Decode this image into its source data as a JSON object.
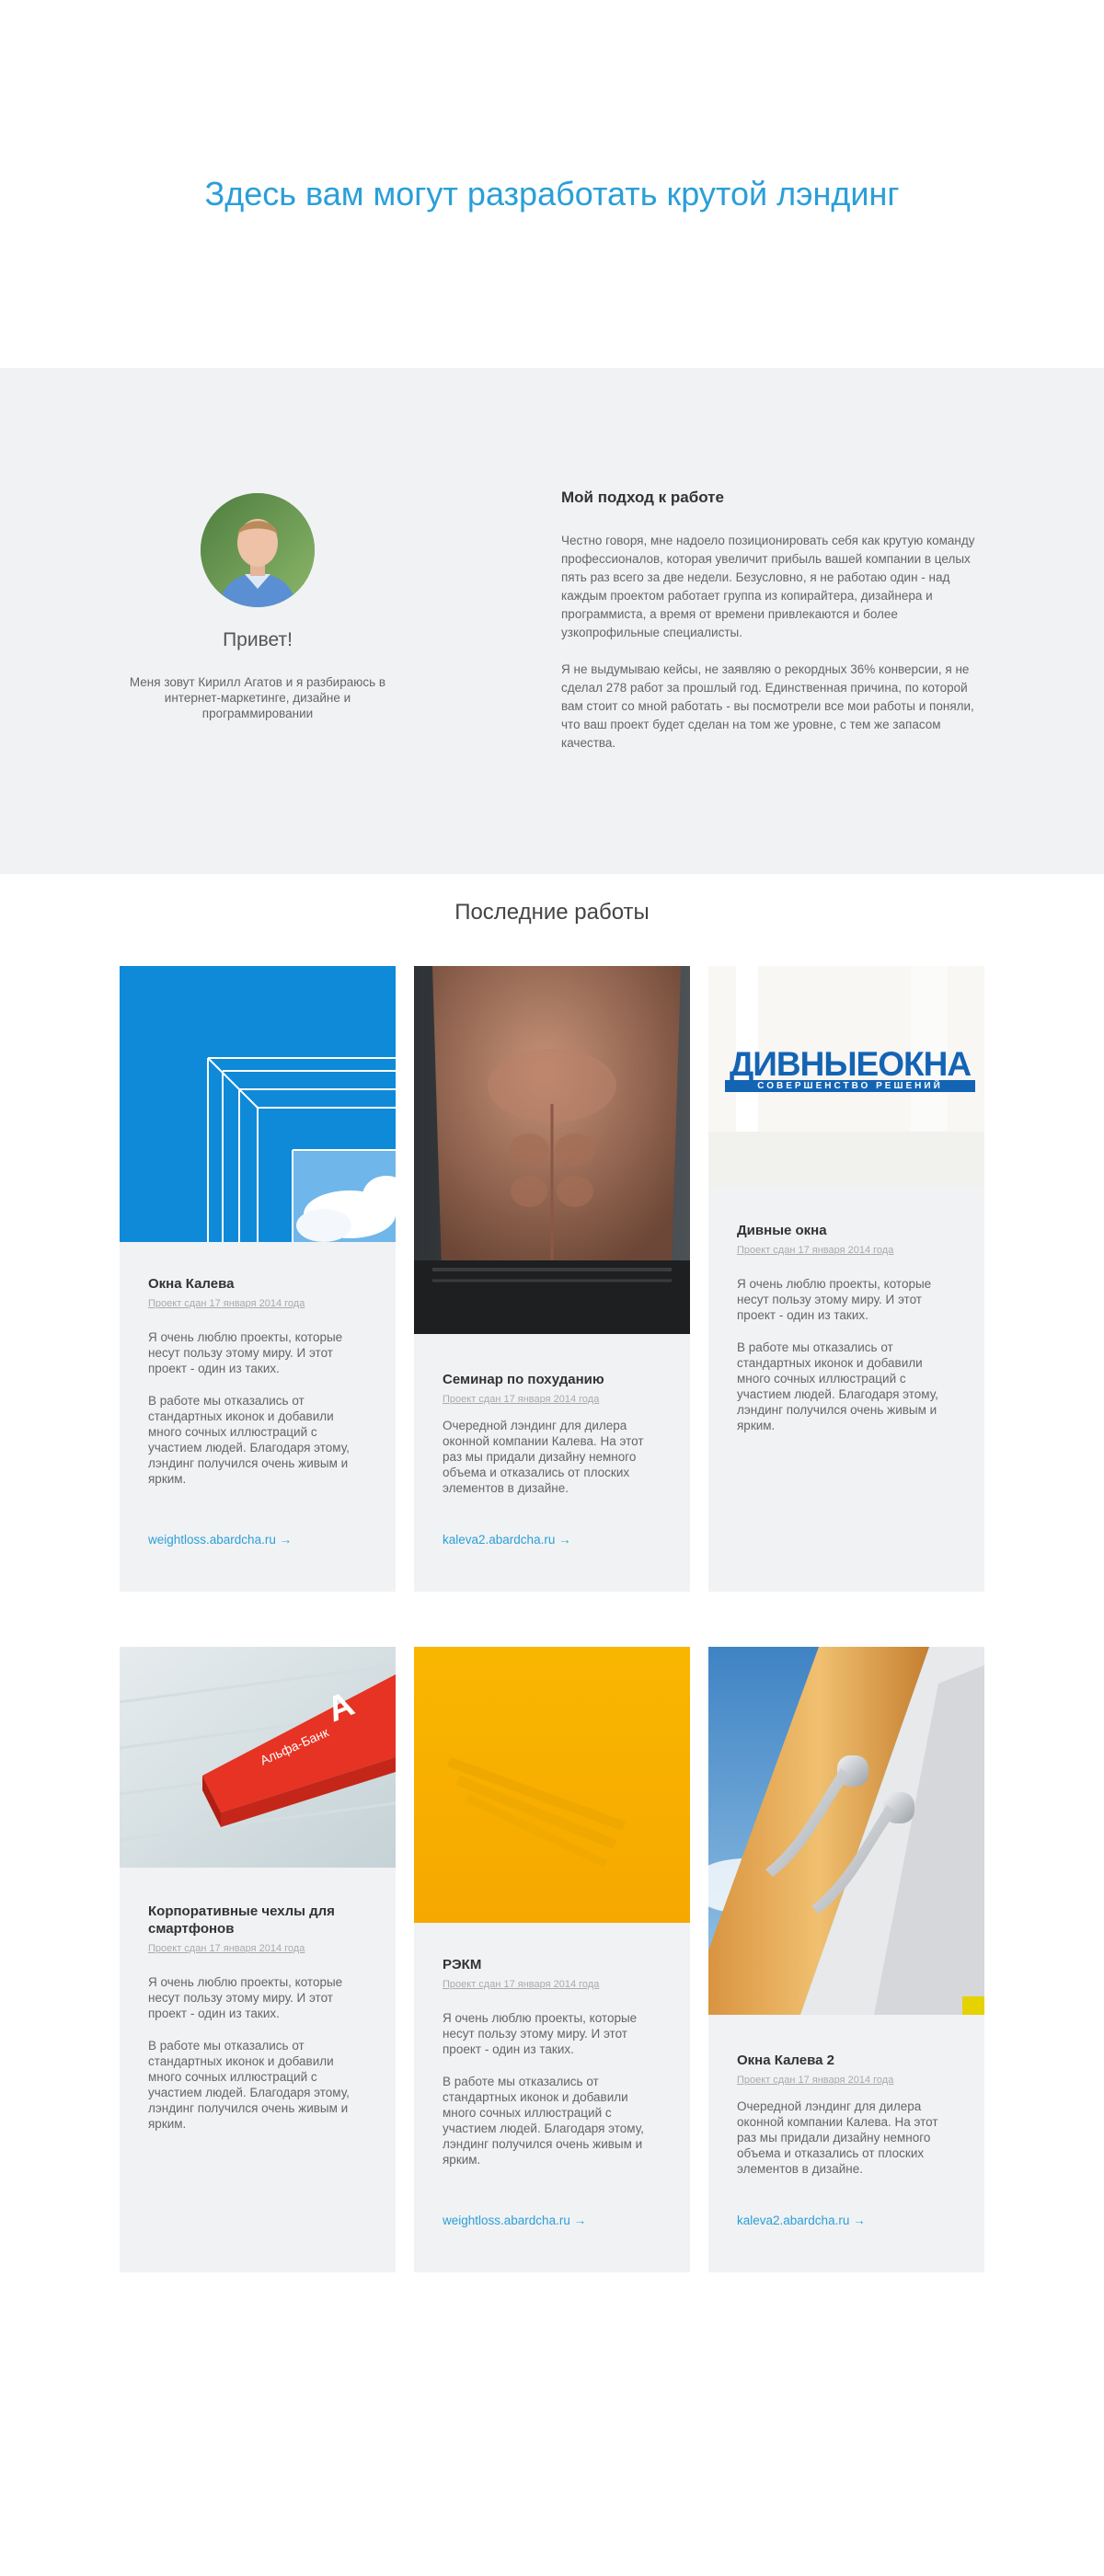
{
  "hero": {
    "title": "Здесь вам могут разработать крутой лэндинг"
  },
  "about": {
    "hello": "Привет!",
    "intro": "Меня зовут Кирилл Агатов и я разбираюсь в интернет-маркетинге, дизайне и программировании",
    "heading": "Мой подход к работе",
    "para1": "Честно говоря, мне надоело позиционировать себя как крутую команду профессионалов, которая увеличит прибыль вашей компании в целых пять раз всего за две недели. Безусловно, я не работаю один - над каждым проектом работает группа из копирайтера, дизайнера и программиста, а время от времени привлекаются и более узкопрофильные специалисты.",
    "para2": "Я не выдумываю кейсы, не заявляю о рекордных 36% конверсии, я не сделал 278 работ за прошлый год. Единственная причина, по которой вам стоит со мной работать - вы посмотрели все мои работы и поняли, что ваш проект будет сделан на том же уровне, с тем же запасом качества."
  },
  "works": {
    "title": "Последние работы",
    "cards": [
      {
        "title": "Окна Калева",
        "date": "Проект сдан 17 января 2014 года",
        "desc": "Я очень люблю проекты, которые несут пользу этому миру. И этот проект - один из таких.",
        "desc2": "В работе мы отказались от стандартных иконок и добавили много сочных иллюстраций с участием людей. Благодаря этому, лэндинг получился очень живым и ярким.",
        "link": "weightloss.abardcha.ru →"
      },
      {
        "title": "Семинар по похуданию",
        "date": "Проект сдан 17 января 2014 года",
        "desc": "Очередной лэндинг для дилера оконной компании Калева. На этот раз мы придали дизайну немного объема и отказались от плоских элементов в дизайне.",
        "desc2": "",
        "link": "kaleva2.abardcha.ru →"
      },
      {
        "title": "Дивные окна",
        "date": "Проект сдан 17 января 2014 года",
        "desc": "Я очень люблю проекты, которые несут пользу этому миру. И этот проект - один из таких.",
        "desc2": "В работе мы отказались от стандартных иконок и добавили много сочных иллюстраций с участием людей. Благодаря этому, лэндинг получился очень живым и ярким.",
        "link": "",
        "logo_main": "ДИВНЫЕОКНА",
        "logo_sub": "СОВЕРШЕНСТВО РЕШЕНИЙ"
      },
      {
        "title": "Корпоративные чехлы для смартфонов",
        "date": "Проект сдан 17 января 2014 года",
        "desc": "Я очень люблю проекты, которые несут пользу этому миру. И этот проект - один из таких.",
        "desc2": "В работе мы отказались от стандартных иконок и добавили много сочных иллюстраций с участием людей. Благодаря этому, лэндинг получился очень живым и ярким.",
        "link": "",
        "bank_label": "Альфа-Банк"
      },
      {
        "title": "РЭКМ",
        "date": "Проект сдан 17 января 2014 года",
        "desc": "Я очень люблю проекты, которые несут пользу этому миру. И этот проект - один из таких.",
        "desc2": "В работе мы отказались от стандартных иконок и добавили много сочных иллюстраций с участием людей. Благодаря этому, лэндинг получился очень живым и ярким.",
        "link": "weightloss.abardcha.ru →"
      },
      {
        "title": "Окна Калева 2",
        "date": "Проект сдан 17 января 2014 года",
        "desc": "Очередной лэндинг для дилера оконной компании Калева. На этот раз мы придали дизайну немного объема и отказались от плоских элементов в дизайне.",
        "desc2": "",
        "link": "kaleva2.abardcha.ru →"
      }
    ]
  },
  "colors": {
    "accent": "#2a9fd8",
    "panel": "#f1f2f4",
    "orange": "#f18a21",
    "yellow": "#f8b400",
    "red": "#e63323"
  }
}
